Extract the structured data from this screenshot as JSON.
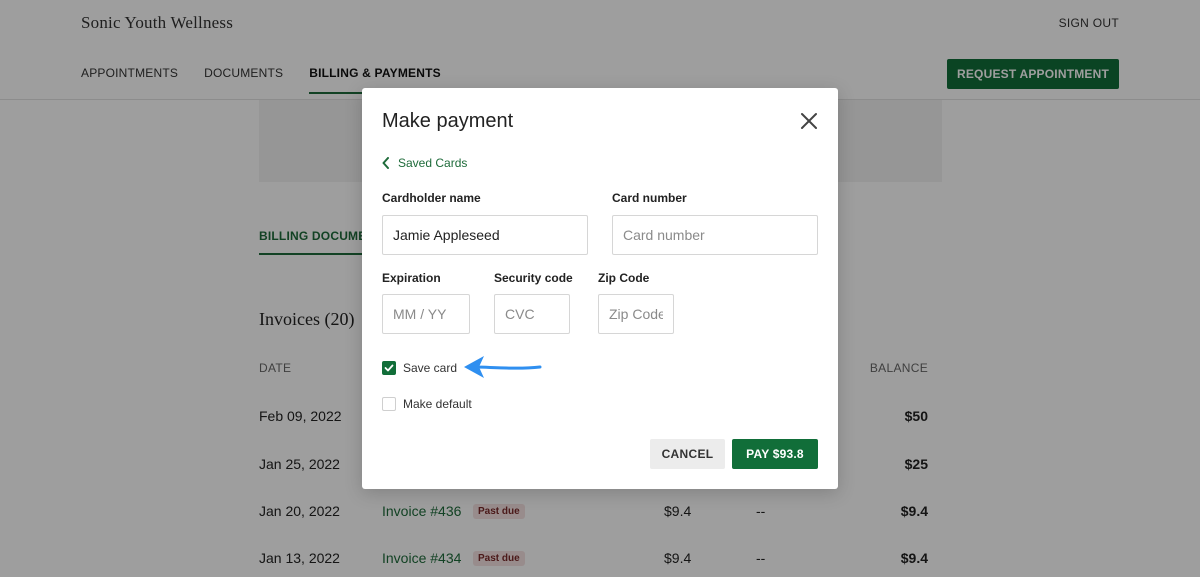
{
  "header": {
    "brand": "Sonic Youth Wellness",
    "sign_out": "SIGN OUT",
    "nav": [
      "APPOINTMENTS",
      "DOCUMENTS",
      "BILLING & PAYMENTS"
    ],
    "request_button": "REQUEST APPOINTMENT"
  },
  "main": {
    "billing_tab": "BILLING DOCUMENTS",
    "invoices_title": "Invoices (20)",
    "columns": {
      "date": "DATE",
      "balance": "BALANCE"
    },
    "rows": [
      {
        "date": "Feb 09, 2022",
        "invoice": "",
        "badge": "",
        "amount": "",
        "paid": "",
        "balance": "$50"
      },
      {
        "date": "Jan 25, 2022",
        "invoice": "",
        "badge": "",
        "amount": "",
        "paid": "",
        "balance": "$25"
      },
      {
        "date": "Jan 20, 2022",
        "invoice": "Invoice #436",
        "badge": "Past due",
        "amount": "$9.4",
        "paid": "--",
        "balance": "$9.4"
      },
      {
        "date": "Jan 13, 2022",
        "invoice": "Invoice #434",
        "badge": "Past due",
        "amount": "$9.4",
        "paid": "--",
        "balance": "$9.4"
      }
    ]
  },
  "modal": {
    "title": "Make payment",
    "back_link": "Saved Cards",
    "cardholder_label": "Cardholder name",
    "cardholder_value": "Jamie Appleseed",
    "card_number_label": "Card number",
    "card_number_placeholder": "Card number",
    "expiration_label": "Expiration",
    "expiration_placeholder": "MM / YY",
    "security_label": "Security code",
    "security_placeholder": "CVC",
    "zip_label": "Zip Code",
    "zip_placeholder": "Zip Code",
    "save_card_label": "Save card",
    "save_card_checked": true,
    "make_default_label": "Make default",
    "make_default_checked": false,
    "cancel_label": "CANCEL",
    "pay_label": "PAY $93.8"
  },
  "colors": {
    "accent": "#116e39",
    "annotation_arrow": "#2f8ff0"
  }
}
